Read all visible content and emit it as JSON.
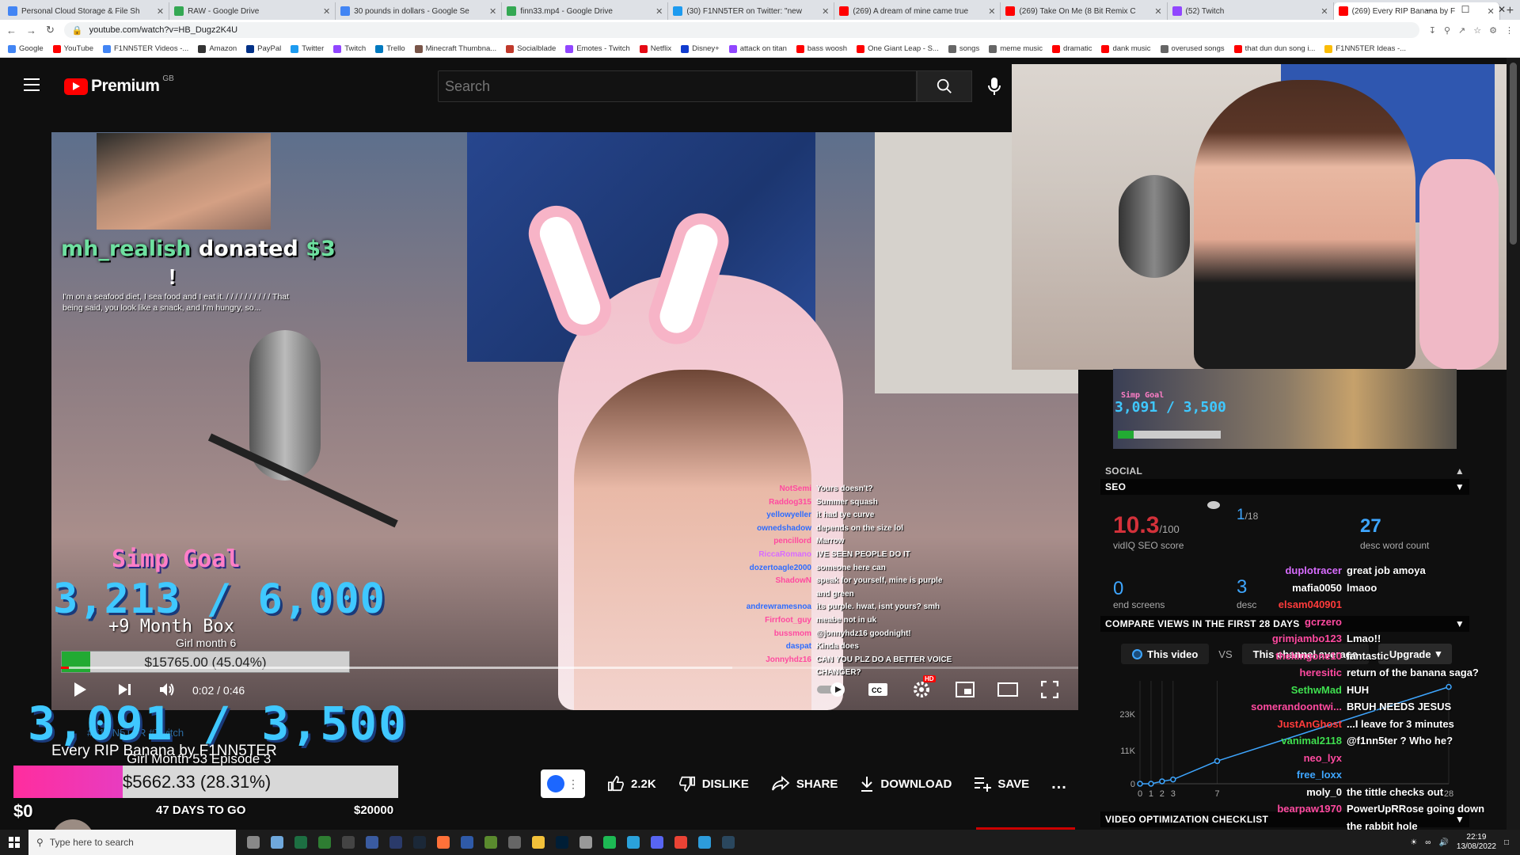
{
  "browser": {
    "tabs": [
      {
        "title": "Personal Cloud Storage & File Sh",
        "color": "#4285f4"
      },
      {
        "title": "RAW - Google Drive",
        "color": "#34a853"
      },
      {
        "title": "30 pounds in dollars - Google Se",
        "color": "#4285f4"
      },
      {
        "title": "finn33.mp4 - Google Drive",
        "color": "#34a853"
      },
      {
        "title": "(30) F1NN5TER on Twitter: \"new",
        "color": "#1d9bf0"
      },
      {
        "title": "(269) A dream of mine came true",
        "color": "#ff0000"
      },
      {
        "title": "(269) Take On Me (8 Bit Remix C",
        "color": "#ff0000"
      },
      {
        "title": "(52) Twitch",
        "color": "#9146ff"
      },
      {
        "title": "(269) Every RIP Banana by F",
        "color": "#ff0000"
      }
    ],
    "new_tab": "+",
    "url": "youtube.com/watch?v=HB_Dugz2K4U",
    "bookmarks": [
      {
        "label": "Google",
        "color": "#4285f4"
      },
      {
        "label": "YouTube",
        "color": "#ff0000"
      },
      {
        "label": "F1NN5TER Videos -...",
        "color": "#4285f4"
      },
      {
        "label": "Amazon",
        "color": "#333"
      },
      {
        "label": "PayPal",
        "color": "#003087"
      },
      {
        "label": "Twitter",
        "color": "#1d9bf0"
      },
      {
        "label": "Twitch",
        "color": "#9146ff"
      },
      {
        "label": "Trello",
        "color": "#0079bf"
      },
      {
        "label": "Minecraft Thumbna...",
        "color": "#795548"
      },
      {
        "label": "Socialblade",
        "color": "#c0392b"
      },
      {
        "label": "Emotes - Twitch",
        "color": "#9146ff"
      },
      {
        "label": "Netflix",
        "color": "#e50914"
      },
      {
        "label": "Disney+",
        "color": "#113ccf"
      },
      {
        "label": "attack on titan",
        "color": "#9146ff"
      },
      {
        "label": "bass woosh",
        "color": "#ff0000"
      },
      {
        "label": "One Giant Leap - S...",
        "color": "#ff0000"
      },
      {
        "label": "songs",
        "color": "#666"
      },
      {
        "label": "meme music",
        "color": "#666"
      },
      {
        "label": "dramatic",
        "color": "#ff0000"
      },
      {
        "label": "dank music",
        "color": "#ff0000"
      },
      {
        "label": "overused songs",
        "color": "#666"
      },
      {
        "label": "that dun dun song i...",
        "color": "#ff0000"
      },
      {
        "label": "F1NN5TER Ideas -...",
        "color": "#fbbc05"
      }
    ]
  },
  "header": {
    "logo_text": "Premium",
    "country": "GB",
    "search_placeholder": "Search"
  },
  "overlay": {
    "donation_user": "mh_realish",
    "donation_word": "donated",
    "donation_amount": "$3",
    "donation_bang": "!",
    "donation_message": "I'm on a seafood diet, I sea food and I eat it. / / / / / / / / / / That being said, you look like a snack, and I'm hungry, so...",
    "simp_title": "Simp Goal",
    "simp_count": "3,213 / 6,000",
    "simp_box": "+9 Month Box",
    "simp_month": "Girl month 6",
    "simp_bar_label": "$15765.00 (45.04%)",
    "simp_progress": 0.1
  },
  "video_chat": [
    {
      "user": "NotSemi",
      "msg": "Yours doesn't?",
      "color": "#ff4aa0"
    },
    {
      "user": "Raddog315",
      "msg": "Summer squash",
      "color": "#ff4aa0"
    },
    {
      "user": "yellowyeller",
      "msg": "it had tye curve",
      "color": "#2d6cff"
    },
    {
      "user": "ownedshadow",
      "msg": "depends on the size lol",
      "color": "#2d6cff"
    },
    {
      "user": "pencillord",
      "msg": "Marrow",
      "color": "#ff4aa0"
    },
    {
      "user": "RiccaRomano",
      "msg": "IVE SEEN PEOPLE DO IT",
      "color": "#d86cff"
    },
    {
      "user": "dozertoagle2000",
      "msg": "someone here can",
      "color": "#2d6cff"
    },
    {
      "user": "ShadowN",
      "msg": "speak for yourself, mine is purple",
      "color": "#ff4aa0"
    },
    {
      "user": "",
      "msg": "and green",
      "color": "#ff4aa0"
    },
    {
      "user": "andrewramesnoa",
      "msg": "its purple. hwat, isnt yours? smh",
      "color": "#2d6cff"
    },
    {
      "user": "Firrfoot_guy",
      "msg": "meabe not in uk",
      "color": "#ff4aa0"
    },
    {
      "user": "bussmom",
      "msg": "@jonnyhdz16 goodnight!",
      "color": "#ff4aa0"
    },
    {
      "user": "daspat",
      "msg": "Kinda does",
      "color": "#2d6cff"
    },
    {
      "user": "Jonnyhdz16",
      "msg": "CAN YOU PLZ DO A BETTER VOICE",
      "color": "#ff4aa0"
    },
    {
      "user": "",
      "msg": "CHANGER?",
      "color": "#ff4aa0"
    }
  ],
  "player": {
    "time_current": "0:02",
    "time_total": "0:46",
    "autoplay_on": true,
    "hd_badge": "HD",
    "progress_played": 0.008,
    "progress_loaded": 0.66
  },
  "page": {
    "goal_count": "3,091 / 3,500",
    "video_title": "Every RIP Banana by F1NN5TER",
    "goal_sub": "Girl Month 53 Episode 3",
    "tags": "#F1NN5TER #Twitch",
    "goal_bar_label": "$5662.33 (28.31%)",
    "goal_progress": 0.2831,
    "goal_min": "$0",
    "goal_days": "47 DAYS TO GO",
    "goal_max": "$20000",
    "likes": "2.2K",
    "dislike": "DISLIKE",
    "share": "SHARE",
    "download": "DOWNLOAD",
    "save": "SAVE",
    "more": "..."
  },
  "vidiq": {
    "social_header": "SOCIAL",
    "seo_header": "SEO",
    "seo_score": "10.3",
    "seo_score_max": "/100",
    "seo_score_label": "vidIQ SEO score",
    "rank": "1",
    "rank_total": "/18",
    "word_count": "27",
    "word_count_label": "desc word count",
    "end_screens": "0",
    "end_screens_label": "end screens",
    "desc_links": "3",
    "desc_links_label": "desc",
    "compare_header": "COMPARE VIEWS IN THE FIRST 28 DAYS",
    "this_video": "This video",
    "vs": "VS",
    "this_channel": "This channel average",
    "upgrade": "Upgrade",
    "checklist_header": "VIDEO OPTIMIZATION CHECKLIST"
  },
  "chart_data": {
    "type": "line",
    "x": [
      0,
      1,
      2,
      3,
      7,
      28
    ],
    "series": [
      {
        "values": [
          0,
          0,
          800,
          1400,
          7500,
          32000
        ]
      }
    ],
    "xticks": [
      "0",
      "1",
      "2",
      "3",
      "7",
      "28"
    ],
    "yticks": [
      "0",
      "11K",
      "23K"
    ],
    "ylim": [
      0,
      34000
    ],
    "color": "#3ea6ff"
  },
  "yt_chat": [
    {
      "user": "duplotracer",
      "msg": "great job amoya",
      "color": "#d86cff"
    },
    {
      "user": "mafia0050",
      "msg": "lmaoo",
      "color": "#ffffff"
    },
    {
      "user": "elsam040901",
      "msg": "",
      "color": "#ff3b3b"
    },
    {
      "user": "gcrzero",
      "msg": "",
      "color": "#ff4aa0"
    },
    {
      "user": "grimjambo123",
      "msg": "Lmao!!",
      "color": "#ff4aa0"
    },
    {
      "user": "",
      "msg": "",
      "color": "#ffffff"
    },
    {
      "user": "thekingone10",
      "msg": "fantastic",
      "color": "#ff4aa0"
    },
    {
      "user": "heresitic",
      "msg": "return of the banana saga?",
      "color": "#ff4aa0"
    },
    {
      "user": "SethwMad",
      "msg": "HUH",
      "color": "#3fdf4f"
    },
    {
      "user": "somerandoontwi...",
      "msg": "BRUH NEEDS JESUS",
      "color": "#ff4aa0"
    },
    {
      "user": "JustAnGhost",
      "msg": "...I leave for 3 minutes",
      "color": "#ff3b3b"
    },
    {
      "user": "vanimal2118",
      "msg": "@f1nn5ter ? Who he?",
      "color": "#3fdf4f"
    },
    {
      "user": "neo_lyx",
      "msg": "",
      "color": "#ff4aa0"
    },
    {
      "user": "free_loxx",
      "msg": "",
      "color": "#3ea6ff"
    },
    {
      "user": "moly_0",
      "msg": "the tittle checks out",
      "color": "#ffffff"
    },
    {
      "user": "bearpaw1970",
      "msg": "PowerUpRRose going down",
      "color": "#ff4aa0"
    },
    {
      "user": "",
      "msg": "the rabbit hole",
      "color": "#ffffff"
    }
  ],
  "taskbar": {
    "search_placeholder": "Type here to search",
    "time": "22:19",
    "date": "13/08/2022"
  }
}
